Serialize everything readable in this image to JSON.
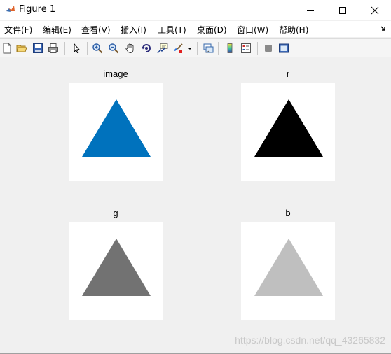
{
  "window": {
    "title": "Figure 1"
  },
  "menu": {
    "items": [
      {
        "label": "文件(F)"
      },
      {
        "label": "编辑(E)"
      },
      {
        "label": "查看(V)"
      },
      {
        "label": "插入(I)"
      },
      {
        "label": "工具(T)"
      },
      {
        "label": "桌面(D)"
      },
      {
        "label": "窗口(W)"
      },
      {
        "label": "帮助(H)"
      }
    ]
  },
  "toolbar": {
    "icons": [
      "new-figure-icon",
      "open-file-icon",
      "save-icon",
      "print-icon",
      "select-arrow-icon",
      "zoom-in-icon",
      "zoom-out-icon",
      "pan-hand-icon",
      "rotate-3d-icon",
      "data-cursor-icon",
      "brush-icon",
      "brush-dropdown-icon",
      "link-plot-icon",
      "insert-colorbar-icon",
      "insert-legend-icon",
      "hide-plot-tools-icon",
      "show-plot-tools-icon"
    ]
  },
  "subplots": [
    {
      "title": "image",
      "fill": "#0072bd"
    },
    {
      "title": "r",
      "fill": "#000000"
    },
    {
      "title": "g",
      "fill": "#727272"
    },
    {
      "title": "b",
      "fill": "#bfbfbf"
    }
  ],
  "watermark": "https://blog.csdn.net/qq_43265832"
}
